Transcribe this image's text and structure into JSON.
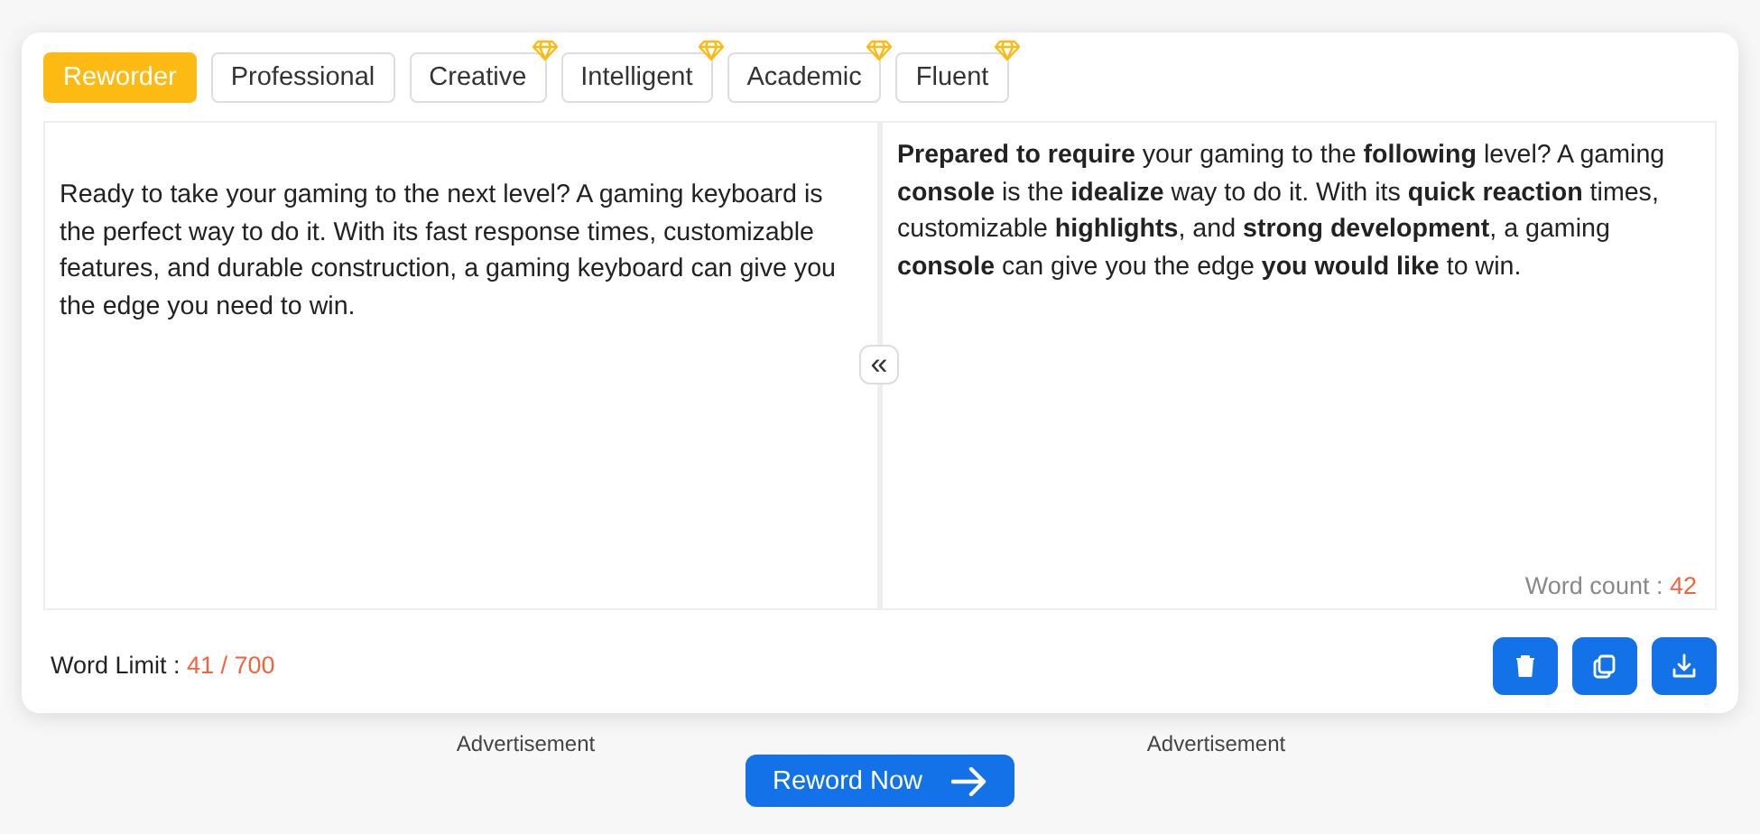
{
  "tabs": [
    {
      "label": "Reworder",
      "selected": true,
      "premium": false
    },
    {
      "label": "Professional",
      "selected": false,
      "premium": false
    },
    {
      "label": "Creative",
      "selected": false,
      "premium": true
    },
    {
      "label": "Intelligent",
      "selected": false,
      "premium": true
    },
    {
      "label": "Academic",
      "selected": false,
      "premium": true
    },
    {
      "label": "Fluent",
      "selected": false,
      "premium": true
    }
  ],
  "input": {
    "text": "Ready to take your gaming to the next level? A gaming keyboard is the perfect way to do it. With its fast response times, customizable features, and durable construction, a gaming keyboard can give you the edge you need to win."
  },
  "swap_button": {
    "label": "«"
  },
  "output": {
    "text": "**Prepared to require** your gaming to the **following** level? A gaming **console** is the **idealize** way to do it. With its **quick reaction** times, customizable **highlights**, and **strong development**, a gaming **console** can give you the edge **you would like** to win.",
    "word_count_label": "Word count :",
    "word_count": "42"
  },
  "word_limit": {
    "label": "Word Limit :",
    "value": "41 / 700"
  },
  "actions": [
    {
      "kind": "delete"
    },
    {
      "kind": "copy"
    },
    {
      "kind": "download"
    }
  ],
  "ads": [
    "Advertisement",
    "Advertisement"
  ],
  "submit": {
    "label": "Reword Now"
  }
}
